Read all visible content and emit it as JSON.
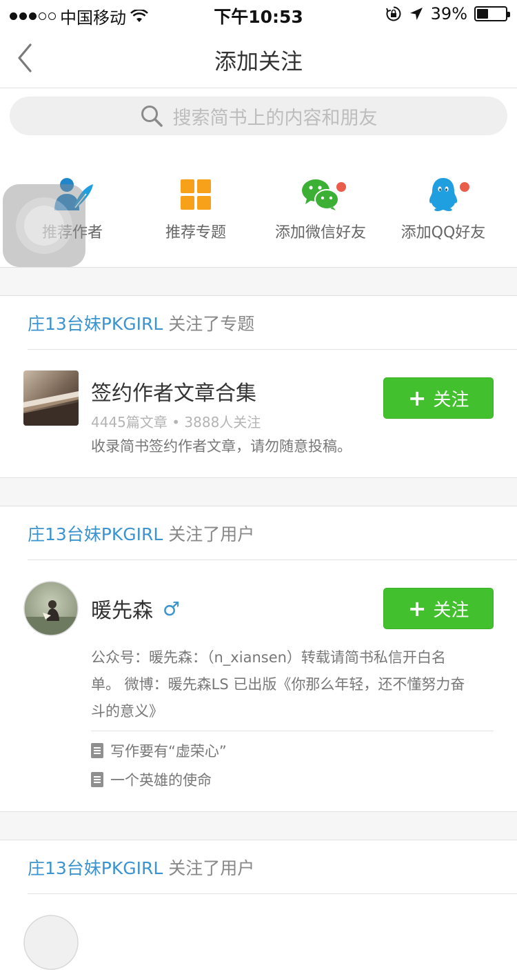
{
  "status_bar": {
    "carrier": "中国移动",
    "time": "下午10:53",
    "battery": "39%",
    "battery_level": 0.39
  },
  "nav": {
    "title": "添加关注"
  },
  "search": {
    "placeholder": "搜索简书上的内容和朋友"
  },
  "quick_actions": [
    {
      "label": "推荐作者",
      "icon": "recommend-author-icon"
    },
    {
      "label": "推荐专题",
      "icon": "recommend-topic-icon"
    },
    {
      "label": "添加微信好友",
      "icon": "wechat-icon",
      "badge": true
    },
    {
      "label": "添加QQ好友",
      "icon": "qq-icon",
      "badge": true
    }
  ],
  "feed": [
    {
      "user": "庄13台妹PKGIRL",
      "action": " 关注了专题",
      "topic": {
        "title": "签约作者文章合集",
        "meta": "4445篇文章 • 3888人关注",
        "description": "收录简书签约作者文章，请勿随意投稿。",
        "follow_label": "关注"
      }
    },
    {
      "user": "庄13台妹PKGIRL",
      "action": " 关注了用户",
      "profile": {
        "name": "暖先森",
        "gender": "♂",
        "bio_lines": [
          "公众号：暖先森：（n_xiansen）转载请简书私信开白名",
          "单。 微博：暖先森LS 已出版《你那么年轻，还不懂努力奋",
          "斗的意义》"
        ],
        "articles": [
          "写作要有“虚荣心”",
          "一个英雄的使命"
        ],
        "follow_label": "关注"
      }
    },
    {
      "user": "庄13台妹PKGIRL",
      "action": " 关注了用户"
    }
  ],
  "colors": {
    "accent_green": "#42c02e",
    "link_blue": "#3b94cf",
    "badge_red": "#ea5d4a",
    "topic_orange": "#f7a11a",
    "qq_blue": "#1f9ee0",
    "wechat_green": "#3cb035"
  }
}
